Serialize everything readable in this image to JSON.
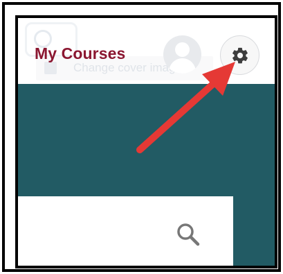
{
  "header": {
    "title": "My Courses",
    "cover_button": {
      "label": "Change cover image",
      "icon": "image-icon"
    },
    "avatar": {
      "icon": "user-avatar-icon"
    },
    "settings_button": {
      "icon": "gear-icon"
    }
  },
  "banner": {
    "color": "#225b64"
  },
  "search": {
    "icon": "search-icon"
  },
  "annotation": {
    "type": "arrow",
    "target": "settings-button",
    "color": "#e53935"
  },
  "colors": {
    "title": "#8b1731",
    "frame": "#000000"
  }
}
